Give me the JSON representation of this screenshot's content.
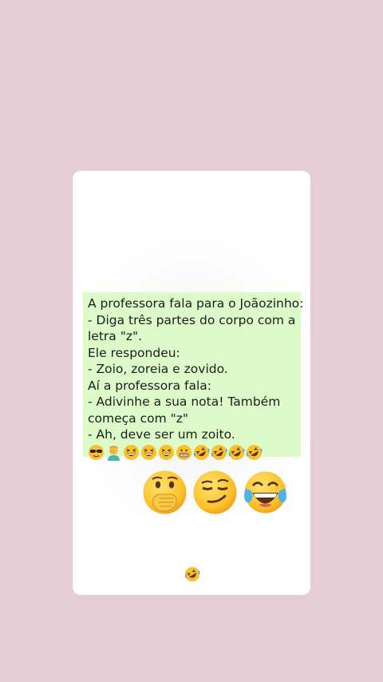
{
  "message": {
    "lines": [
      "A professora fala para o Joãozinho:",
      "- Diga três partes do corpo com a",
      "letra \"z\".",
      "Ele respondeu:",
      "- Zoio, zoreia e zovido.",
      "Aí a professora fala:",
      "- Adivinhe a sua nota! Também",
      "começa com \"z\"",
      "- Ah, deve ser um zoito."
    ],
    "emoji_row": [
      "sunglasses-face",
      "person-facepalming",
      "grinning-squinting-face",
      "grinning-squinting-face",
      "grinning-squinting-face",
      "grimacing-face",
      "rolling-on-floor-laughing",
      "rolling-on-floor-laughing",
      "rolling-on-floor-laughing",
      "rolling-on-floor-laughing"
    ]
  },
  "reactions": [
    "face-with-hand-over-mouth",
    "smirking-face",
    "face-with-tears-of-joy"
  ],
  "footer_emoji": "rolling-on-floor-laughing",
  "colors": {
    "background": "#e5cdd6",
    "card": "#ffffff",
    "message_bubble": "#dcfbc8"
  }
}
